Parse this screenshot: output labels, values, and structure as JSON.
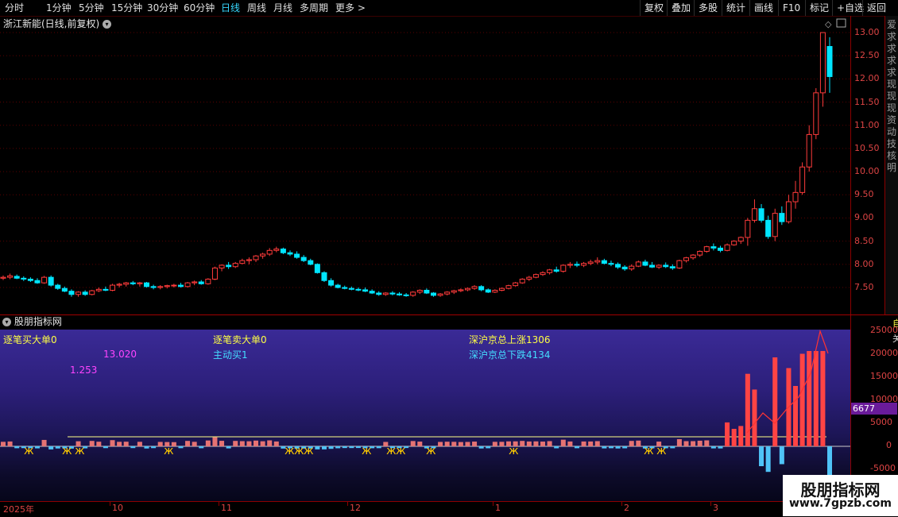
{
  "toolbar": {
    "periods": [
      "分时",
      "1分钟",
      "5分钟",
      "15分钟",
      "30分钟",
      "60分钟",
      "日线",
      "周线",
      "月线",
      "多周期",
      "更多"
    ],
    "active_period": "日线",
    "more_arrow": ">",
    "right_buttons": [
      "复权",
      "叠加",
      "多股",
      "统计",
      "画线",
      "F10",
      "标记",
      "+自选",
      "返回"
    ]
  },
  "stock": {
    "title": "浙江新能(日线,前复权)"
  },
  "price_axis": {
    "labels": [
      "13.00",
      "12.50",
      "12.00",
      "11.50",
      "11.00",
      "10.50",
      "10.00",
      "9.50",
      "9.00",
      "8.50",
      "8.00",
      "7.50"
    ]
  },
  "side_strip": {
    "text": "爱求求求求现现现资动技核明"
  },
  "indicator": {
    "title": "股朋指标网",
    "labels": {
      "big_buy": "逐笔买大单0",
      "big_sell": "逐笔卖大单0",
      "active_buy": "主动买1",
      "market_up": "深沪京总上涨1306",
      "market_down": "深沪京总下跌4134",
      "val_a": "13.020",
      "val_b": "1.253"
    },
    "axis_labels": [
      "25000",
      "20000",
      "15000",
      "10000",
      "5000",
      "0",
      "-5000"
    ],
    "axis_current": "6677",
    "axis_top_glyph": "自",
    "axis_second_glyph": "关"
  },
  "date_axis": {
    "labels": [
      "2025年",
      "10",
      "11",
      "12",
      "1",
      "2",
      "3"
    ]
  },
  "watermark": {
    "title": "股朋指标网",
    "url": "www.7gpzb.com"
  },
  "colors": {
    "up": "#ff3b3b",
    "down": "#00e5ff",
    "grid": "#5a0000",
    "panel_top": "#3a2a96",
    "yellow": "#ffff44",
    "magenta": "#ff44ff",
    "cyan": "#44ddff"
  },
  "chart_data": {
    "type": "candlestick",
    "ylim": [
      7.3,
      13.1
    ],
    "candles": [
      {
        "o": 7.7,
        "h": 7.76,
        "l": 7.66,
        "c": 7.72
      },
      {
        "o": 7.72,
        "h": 7.8,
        "l": 7.68,
        "c": 7.75
      },
      {
        "o": 7.74,
        "h": 7.78,
        "l": 7.68,
        "c": 7.7
      },
      {
        "o": 7.7,
        "h": 7.74,
        "l": 7.64,
        "c": 7.68
      },
      {
        "o": 7.68,
        "h": 7.72,
        "l": 7.62,
        "c": 7.65
      },
      {
        "o": 7.65,
        "h": 7.7,
        "l": 7.58,
        "c": 7.6
      },
      {
        "o": 7.6,
        "h": 7.75,
        "l": 7.58,
        "c": 7.72
      },
      {
        "o": 7.72,
        "h": 7.76,
        "l": 7.52,
        "c": 7.55
      },
      {
        "o": 7.55,
        "h": 7.58,
        "l": 7.45,
        "c": 7.48
      },
      {
        "o": 7.48,
        "h": 7.52,
        "l": 7.4,
        "c": 7.42
      },
      {
        "o": 7.42,
        "h": 7.46,
        "l": 7.3,
        "c": 7.35
      },
      {
        "o": 7.35,
        "h": 7.42,
        "l": 7.3,
        "c": 7.4
      },
      {
        "o": 7.4,
        "h": 7.44,
        "l": 7.32,
        "c": 7.35
      },
      {
        "o": 7.35,
        "h": 7.45,
        "l": 7.33,
        "c": 7.43
      },
      {
        "o": 7.43,
        "h": 7.5,
        "l": 7.4,
        "c": 7.46
      },
      {
        "o": 7.46,
        "h": 7.52,
        "l": 7.42,
        "c": 7.44
      },
      {
        "o": 7.44,
        "h": 7.58,
        "l": 7.42,
        "c": 7.55
      },
      {
        "o": 7.55,
        "h": 7.6,
        "l": 7.5,
        "c": 7.57
      },
      {
        "o": 7.57,
        "h": 7.62,
        "l": 7.52,
        "c": 7.6
      },
      {
        "o": 7.6,
        "h": 7.64,
        "l": 7.55,
        "c": 7.58
      },
      {
        "o": 7.58,
        "h": 7.62,
        "l": 7.52,
        "c": 7.6
      },
      {
        "o": 7.6,
        "h": 7.62,
        "l": 7.5,
        "c": 7.52
      },
      {
        "o": 7.52,
        "h": 7.56,
        "l": 7.46,
        "c": 7.5
      },
      {
        "o": 7.5,
        "h": 7.55,
        "l": 7.46,
        "c": 7.52
      },
      {
        "o": 7.52,
        "h": 7.56,
        "l": 7.48,
        "c": 7.54
      },
      {
        "o": 7.54,
        "h": 7.58,
        "l": 7.5,
        "c": 7.55
      },
      {
        "o": 7.55,
        "h": 7.6,
        "l": 7.5,
        "c": 7.52
      },
      {
        "o": 7.52,
        "h": 7.62,
        "l": 7.5,
        "c": 7.6
      },
      {
        "o": 7.6,
        "h": 7.65,
        "l": 7.55,
        "c": 7.62
      },
      {
        "o": 7.62,
        "h": 7.66,
        "l": 7.56,
        "c": 7.58
      },
      {
        "o": 7.58,
        "h": 7.7,
        "l": 7.56,
        "c": 7.68
      },
      {
        "o": 7.68,
        "h": 7.95,
        "l": 7.66,
        "c": 7.92
      },
      {
        "o": 7.92,
        "h": 8.0,
        "l": 7.85,
        "c": 7.98
      },
      {
        "o": 7.98,
        "h": 8.05,
        "l": 7.9,
        "c": 7.95
      },
      {
        "o": 7.95,
        "h": 8.05,
        "l": 7.92,
        "c": 8.02
      },
      {
        "o": 8.02,
        "h": 8.12,
        "l": 8.0,
        "c": 8.08
      },
      {
        "o": 8.08,
        "h": 8.15,
        "l": 8.0,
        "c": 8.1
      },
      {
        "o": 8.1,
        "h": 8.2,
        "l": 8.05,
        "c": 8.18
      },
      {
        "o": 8.18,
        "h": 8.25,
        "l": 8.12,
        "c": 8.22
      },
      {
        "o": 8.22,
        "h": 8.35,
        "l": 8.18,
        "c": 8.3
      },
      {
        "o": 8.3,
        "h": 8.38,
        "l": 8.26,
        "c": 8.33
      },
      {
        "o": 8.33,
        "h": 8.36,
        "l": 8.22,
        "c": 8.25
      },
      {
        "o": 8.25,
        "h": 8.3,
        "l": 8.18,
        "c": 8.22
      },
      {
        "o": 8.22,
        "h": 8.28,
        "l": 8.12,
        "c": 8.15
      },
      {
        "o": 8.15,
        "h": 8.2,
        "l": 8.05,
        "c": 8.08
      },
      {
        "o": 8.08,
        "h": 8.12,
        "l": 7.98,
        "c": 8.0
      },
      {
        "o": 8.0,
        "h": 8.02,
        "l": 7.8,
        "c": 7.82
      },
      {
        "o": 7.82,
        "h": 7.85,
        "l": 7.62,
        "c": 7.65
      },
      {
        "o": 7.65,
        "h": 7.7,
        "l": 7.52,
        "c": 7.55
      },
      {
        "o": 7.55,
        "h": 7.58,
        "l": 7.48,
        "c": 7.5
      },
      {
        "o": 7.5,
        "h": 7.54,
        "l": 7.46,
        "c": 7.48
      },
      {
        "o": 7.48,
        "h": 7.52,
        "l": 7.44,
        "c": 7.46
      },
      {
        "o": 7.46,
        "h": 7.5,
        "l": 7.42,
        "c": 7.45
      },
      {
        "o": 7.45,
        "h": 7.5,
        "l": 7.4,
        "c": 7.42
      },
      {
        "o": 7.42,
        "h": 7.46,
        "l": 7.36,
        "c": 7.38
      },
      {
        "o": 7.38,
        "h": 7.42,
        "l": 7.32,
        "c": 7.35
      },
      {
        "o": 7.35,
        "h": 7.4,
        "l": 7.32,
        "c": 7.38
      },
      {
        "o": 7.38,
        "h": 7.42,
        "l": 7.33,
        "c": 7.36
      },
      {
        "o": 7.36,
        "h": 7.4,
        "l": 7.32,
        "c": 7.34
      },
      {
        "o": 7.34,
        "h": 7.38,
        "l": 7.3,
        "c": 7.33
      },
      {
        "o": 7.33,
        "h": 7.42,
        "l": 7.3,
        "c": 7.4
      },
      {
        "o": 7.4,
        "h": 7.46,
        "l": 7.36,
        "c": 7.44
      },
      {
        "o": 7.44,
        "h": 7.48,
        "l": 7.36,
        "c": 7.38
      },
      {
        "o": 7.38,
        "h": 7.4,
        "l": 7.3,
        "c": 7.33
      },
      {
        "o": 7.33,
        "h": 7.38,
        "l": 7.3,
        "c": 7.36
      },
      {
        "o": 7.36,
        "h": 7.42,
        "l": 7.33,
        "c": 7.4
      },
      {
        "o": 7.4,
        "h": 7.45,
        "l": 7.36,
        "c": 7.43
      },
      {
        "o": 7.43,
        "h": 7.48,
        "l": 7.4,
        "c": 7.45
      },
      {
        "o": 7.45,
        "h": 7.5,
        "l": 7.42,
        "c": 7.48
      },
      {
        "o": 7.48,
        "h": 7.55,
        "l": 7.45,
        "c": 7.52
      },
      {
        "o": 7.52,
        "h": 7.55,
        "l": 7.42,
        "c": 7.45
      },
      {
        "o": 7.45,
        "h": 7.48,
        "l": 7.38,
        "c": 7.4
      },
      {
        "o": 7.4,
        "h": 7.46,
        "l": 7.38,
        "c": 7.44
      },
      {
        "o": 7.44,
        "h": 7.5,
        "l": 7.42,
        "c": 7.48
      },
      {
        "o": 7.48,
        "h": 7.56,
        "l": 7.46,
        "c": 7.54
      },
      {
        "o": 7.54,
        "h": 7.62,
        "l": 7.52,
        "c": 7.6
      },
      {
        "o": 7.6,
        "h": 7.7,
        "l": 7.58,
        "c": 7.68
      },
      {
        "o": 7.68,
        "h": 7.75,
        "l": 7.64,
        "c": 7.72
      },
      {
        "o": 7.72,
        "h": 7.8,
        "l": 7.7,
        "c": 7.78
      },
      {
        "o": 7.78,
        "h": 7.85,
        "l": 7.75,
        "c": 7.82
      },
      {
        "o": 7.82,
        "h": 7.9,
        "l": 7.78,
        "c": 7.88
      },
      {
        "o": 7.88,
        "h": 7.95,
        "l": 7.82,
        "c": 7.85
      },
      {
        "o": 7.85,
        "h": 8.0,
        "l": 7.82,
        "c": 7.98
      },
      {
        "o": 7.98,
        "h": 8.05,
        "l": 7.92,
        "c": 8.0
      },
      {
        "o": 8.0,
        "h": 8.06,
        "l": 7.94,
        "c": 7.98
      },
      {
        "o": 7.98,
        "h": 8.05,
        "l": 7.94,
        "c": 8.02
      },
      {
        "o": 8.02,
        "h": 8.1,
        "l": 7.98,
        "c": 8.05
      },
      {
        "o": 8.05,
        "h": 8.15,
        "l": 8.0,
        "c": 8.08
      },
      {
        "o": 8.08,
        "h": 8.12,
        "l": 8.0,
        "c": 8.02
      },
      {
        "o": 8.02,
        "h": 8.08,
        "l": 7.96,
        "c": 8.0
      },
      {
        "o": 8.0,
        "h": 8.04,
        "l": 7.9,
        "c": 7.94
      },
      {
        "o": 7.94,
        "h": 7.98,
        "l": 7.86,
        "c": 7.9
      },
      {
        "o": 7.9,
        "h": 8.0,
        "l": 7.86,
        "c": 7.96
      },
      {
        "o": 7.96,
        "h": 8.08,
        "l": 7.94,
        "c": 8.05
      },
      {
        "o": 8.05,
        "h": 8.1,
        "l": 7.96,
        "c": 7.98
      },
      {
        "o": 7.98,
        "h": 8.05,
        "l": 7.92,
        "c": 7.94
      },
      {
        "o": 7.94,
        "h": 8.0,
        "l": 7.9,
        "c": 7.98
      },
      {
        "o": 7.98,
        "h": 8.04,
        "l": 7.92,
        "c": 7.95
      },
      {
        "o": 7.95,
        "h": 8.0,
        "l": 7.88,
        "c": 7.92
      },
      {
        "o": 7.92,
        "h": 8.1,
        "l": 7.9,
        "c": 8.08
      },
      {
        "o": 8.08,
        "h": 8.16,
        "l": 8.04,
        "c": 8.14
      },
      {
        "o": 8.14,
        "h": 8.22,
        "l": 8.1,
        "c": 8.2
      },
      {
        "o": 8.2,
        "h": 8.3,
        "l": 8.16,
        "c": 8.28
      },
      {
        "o": 8.28,
        "h": 8.4,
        "l": 8.25,
        "c": 8.38
      },
      {
        "o": 8.38,
        "h": 8.45,
        "l": 8.3,
        "c": 8.35
      },
      {
        "o": 8.35,
        "h": 8.4,
        "l": 8.26,
        "c": 8.3
      },
      {
        "o": 8.3,
        "h": 8.45,
        "l": 8.28,
        "c": 8.42
      },
      {
        "o": 8.42,
        "h": 8.52,
        "l": 8.4,
        "c": 8.5
      },
      {
        "o": 8.5,
        "h": 8.6,
        "l": 8.44,
        "c": 8.58
      },
      {
        "o": 8.58,
        "h": 9.0,
        "l": 8.4,
        "c": 8.95
      },
      {
        "o": 8.95,
        "h": 9.4,
        "l": 8.9,
        "c": 9.2
      },
      {
        "o": 9.2,
        "h": 9.3,
        "l": 8.9,
        "c": 8.95
      },
      {
        "o": 8.95,
        "h": 9.05,
        "l": 8.55,
        "c": 8.6
      },
      {
        "o": 8.6,
        "h": 9.2,
        "l": 8.5,
        "c": 9.1
      },
      {
        "o": 9.1,
        "h": 9.25,
        "l": 8.85,
        "c": 8.92
      },
      {
        "o": 8.92,
        "h": 9.5,
        "l": 8.88,
        "c": 9.35
      },
      {
        "o": 9.35,
        "h": 9.8,
        "l": 9.2,
        "c": 9.55
      },
      {
        "o": 9.55,
        "h": 10.2,
        "l": 9.5,
        "c": 10.1
      },
      {
        "o": 10.1,
        "h": 11.0,
        "l": 10.0,
        "c": 10.8
      },
      {
        "o": 10.8,
        "h": 11.8,
        "l": 10.7,
        "c": 11.7
      },
      {
        "o": 11.7,
        "h": 13.0,
        "l": 11.4,
        "c": 13.0
      },
      {
        "o": 12.7,
        "h": 12.9,
        "l": 11.7,
        "c": 12.05
      }
    ]
  }
}
